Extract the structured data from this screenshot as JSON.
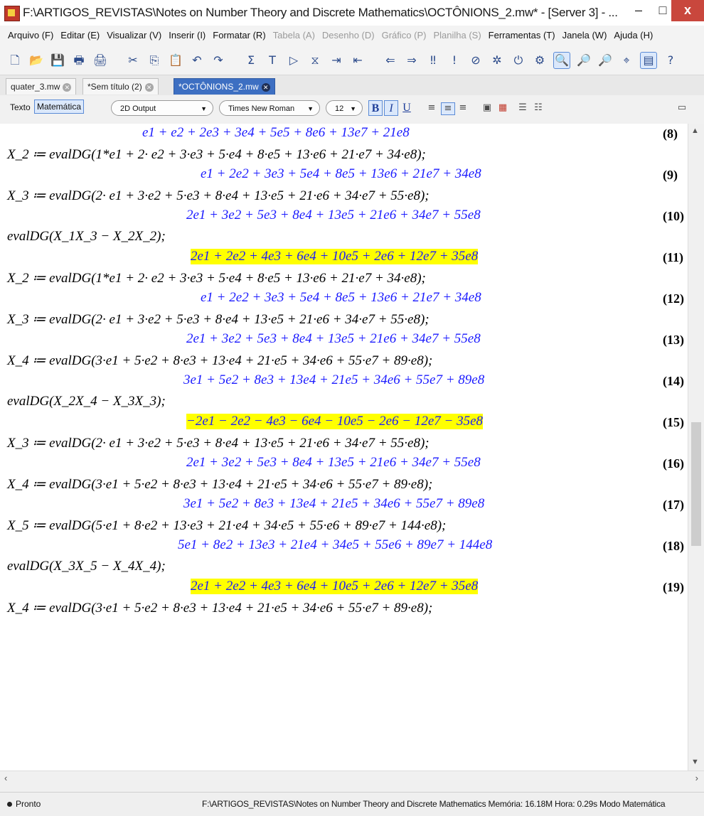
{
  "window": {
    "title": "F:\\ARTIGOS_REVISTAS\\Notes on Number Theory and Discrete Mathematics\\OCTÔNIONS_2.mw* - [Server 3] - ...",
    "min_label": "–",
    "max_label": "□",
    "close_label": "x"
  },
  "menu": [
    {
      "label": "Arquivo (F)",
      "disabled": false
    },
    {
      "label": "Editar (E)",
      "disabled": false
    },
    {
      "label": "Visualizar (V)",
      "disabled": false
    },
    {
      "label": "Inserir (I)",
      "disabled": false
    },
    {
      "label": "Formatar (R)",
      "disabled": false
    },
    {
      "label": "Tabela (A)",
      "disabled": true
    },
    {
      "label": "Desenho (D)",
      "disabled": true
    },
    {
      "label": "Gráfico (P)",
      "disabled": true
    },
    {
      "label": "Planilha (S)",
      "disabled": true
    },
    {
      "label": "Ferramentas (T)",
      "disabled": false
    },
    {
      "label": "Janela (W)",
      "disabled": false
    },
    {
      "label": "Ajuda (H)",
      "disabled": false
    }
  ],
  "tabs": [
    {
      "label": "quater_3.mw",
      "active": false
    },
    {
      "label": "*Sem título (2)",
      "active": false
    },
    {
      "label": "*OCTÔNIONS_2.mw",
      "active": true
    }
  ],
  "format_bar": {
    "text_mode": "Texto",
    "math_mode": "Matemática",
    "output_mode": "2D Output",
    "font": "Times New Roman",
    "size": "12",
    "bold": "B",
    "italic": "I",
    "underline": "U"
  },
  "document": {
    "lines": [
      {
        "kind": "out",
        "text": "e1 + e2 + 2e3 + 3e4 + 5e5 + 8e6 + 13e7 + 21e8",
        "num": "(8)",
        "highlight": false
      },
      {
        "kind": "in",
        "text": "X_2 ≔ evalDG(1*e1 + 2· e2 + 3·e3 + 5·e4 + 8·e5 + 13·e6 + 21·e7 + 34·e8);"
      },
      {
        "kind": "out",
        "text": "e1 + 2e2 + 3e3 + 5e4 + 8e5 + 13e6 + 21e7 + 34e8",
        "num": "(9)",
        "highlight": false
      },
      {
        "kind": "in",
        "text": "X_3 ≔ evalDG(2· e1 + 3·e2 + 5·e3 + 8·e4 + 13·e5 + 21·e6 + 34·e7 + 55·e8);"
      },
      {
        "kind": "out",
        "text": "2e1 + 3e2 + 5e3 + 8e4 + 13e5 + 21e6 + 34e7 + 55e8",
        "num": "(10)",
        "highlight": false
      },
      {
        "kind": "in",
        "text": "evalDG(X_1X_3 − X_2X_2);"
      },
      {
        "kind": "out",
        "text": "2e1 + 2e2 + 4e3 + 6e4 + 10e5 + 2e6 + 12e7 + 35e8",
        "num": "(11)",
        "highlight": true
      },
      {
        "kind": "in",
        "text": "X_2 ≔ evalDG(1*e1 + 2· e2 + 3·e3 + 5·e4 + 8·e5 + 13·e6 + 21·e7 + 34·e8);"
      },
      {
        "kind": "out",
        "text": "e1 + 2e2 + 3e3 + 5e4 + 8e5 + 13e6 + 21e7 + 34e8",
        "num": "(12)",
        "highlight": false
      },
      {
        "kind": "in",
        "text": "X_3 ≔ evalDG(2· e1 + 3·e2 + 5·e3 + 8·e4 + 13·e5 + 21·e6 + 34·e7 + 55·e8);"
      },
      {
        "kind": "out",
        "text": "2e1 + 3e2 + 5e3 + 8e4 + 13e5 + 21e6 + 34e7 + 55e8",
        "num": "(13)",
        "highlight": false
      },
      {
        "kind": "in",
        "text": "X_4 ≔ evalDG(3·e1 + 5·e2 + 8·e3 + 13·e4 + 21·e5 + 34·e6 + 55·e7 + 89·e8);"
      },
      {
        "kind": "out",
        "text": "3e1 + 5e2 + 8e3 + 13e4 + 21e5 + 34e6 + 55e7 + 89e8",
        "num": "(14)",
        "highlight": false
      },
      {
        "kind": "in",
        "text": "evalDG(X_2X_4 − X_3X_3);"
      },
      {
        "kind": "out",
        "text": "−2e1 − 2e2 − 4e3 − 6e4 − 10e5 − 2e6 − 12e7 − 35e8",
        "num": "(15)",
        "highlight": true
      },
      {
        "kind": "in",
        "text": "X_3 ≔ evalDG(2· e1 + 3·e2 + 5·e3 + 8·e4 + 13·e5 + 21·e6 + 34·e7 + 55·e8);"
      },
      {
        "kind": "out",
        "text": "2e1 + 3e2 + 5e3 + 8e4 + 13e5 + 21e6 + 34e7 + 55e8",
        "num": "(16)",
        "highlight": false
      },
      {
        "kind": "in",
        "text": "X_4 ≔ evalDG(3·e1 + 5·e2 + 8·e3 + 13·e4 + 21·e5 + 34·e6 + 55·e7 + 89·e8);"
      },
      {
        "kind": "out",
        "text": "3e1 + 5e2 + 8e3 + 13e4 + 21e5 + 34e6 + 55e7 + 89e8",
        "num": "(17)",
        "highlight": false
      },
      {
        "kind": "in",
        "text": "X_5 ≔ evalDG(5·e1 + 8·e2 + 13·e3 + 21·e4 + 34·e5 + 55·e6 + 89·e7 + 144·e8);"
      },
      {
        "kind": "out",
        "text": "5e1 + 8e2 + 13e3 + 21e4 + 34e5 + 55e6 + 89e7 + 144e8",
        "num": "(18)",
        "highlight": false
      },
      {
        "kind": "in",
        "text": "evalDG(X_3X_5 − X_4X_4);"
      },
      {
        "kind": "out",
        "text": "2e1 + 2e2 + 4e3 + 6e4 + 10e5 + 2e6 + 12e7 + 35e8",
        "num": "(19)",
        "highlight": true
      },
      {
        "kind": "in",
        "text": "X_4 ≔ evalDG(3·e1 + 5·e2 + 8·e3 + 13·e4 + 21·e5 + 34·e6 + 55·e7 + 89·e8);"
      }
    ]
  },
  "status": {
    "ready": "Pronto",
    "info": "F:\\ARTIGOS_REVISTAS\\Notes on Number Theory and Discrete Mathematics   Memória: 16.18M   Hora: 0.29s   Modo Matemática"
  },
  "colors": {
    "output_blue": "#1a1aff",
    "highlight_yellow": "#ffff00",
    "active_tab": "#3d6fc2",
    "close_button": "#c9473d"
  }
}
